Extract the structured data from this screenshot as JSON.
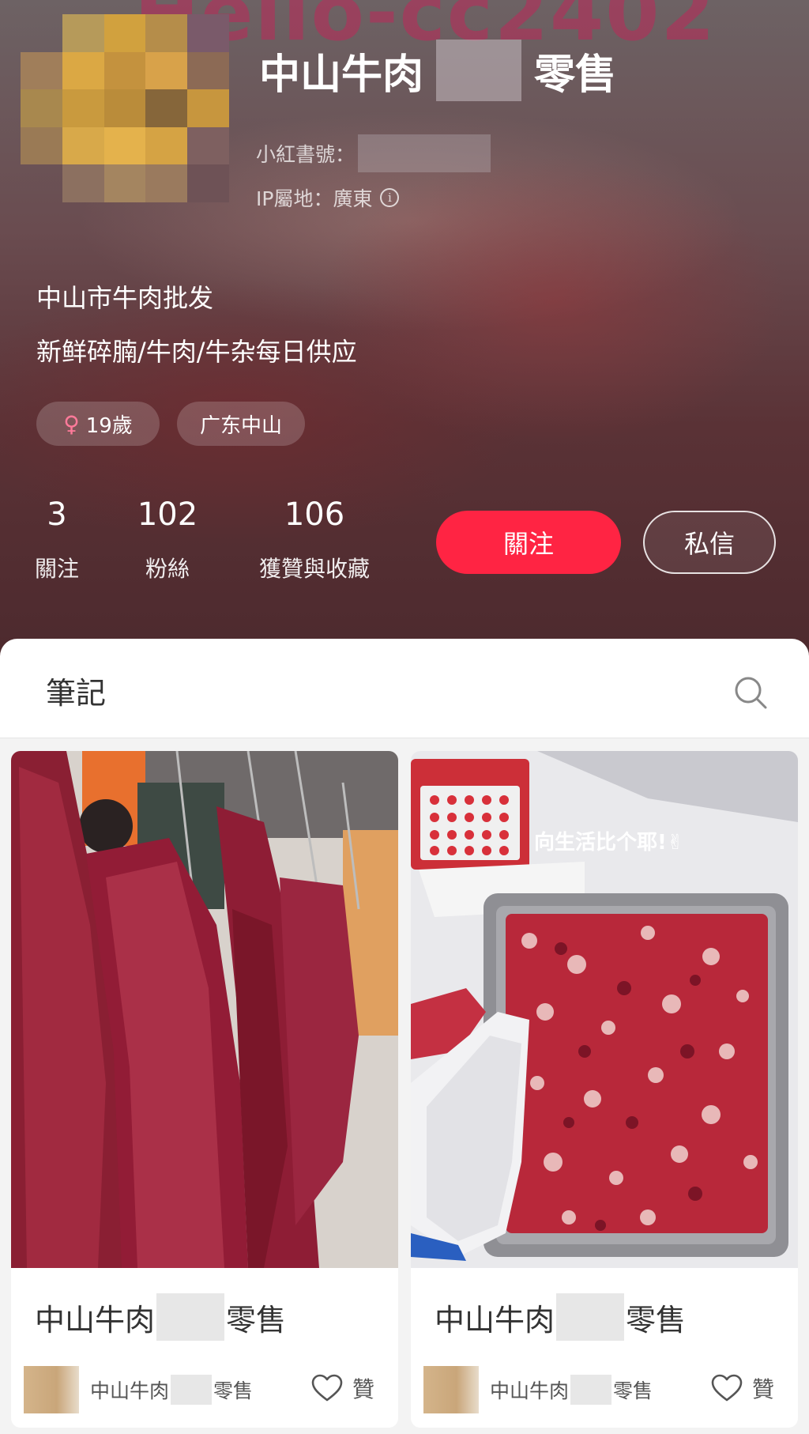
{
  "watermark": {
    "text": "Hello-cc2402"
  },
  "profile": {
    "name_part1": "中山牛肉",
    "name_part2": "零售",
    "redbook_id_label": "小紅書號：",
    "ip_label": "IP屬地：廣東",
    "info_icon": "i",
    "bio_line1": "中山市牛肉批发",
    "bio_line2": "新鲜碎腩/牛肉/牛杂每日供应",
    "tags": {
      "gender_symbol": "♀",
      "age": "19歲",
      "location": "广东中山"
    },
    "stats": {
      "following_count": "3",
      "following_label": "關注",
      "fans_count": "102",
      "fans_label": "粉絲",
      "likes_count": "106",
      "likes_label": "獲贊與收藏"
    },
    "follow_button": "關注",
    "message_button": "私信"
  },
  "notes": {
    "title": "筆記",
    "cards": [
      {
        "title_part1": "中山牛肉",
        "title_part2": "零售",
        "author_part1": "中山牛肉",
        "author_part2": "零售",
        "like_label": "贊"
      },
      {
        "title_part1": "中山牛肉",
        "title_part2": "零售",
        "author_part1": "中山牛肉",
        "author_part2": "零售",
        "like_label": "贊",
        "image_caption": "向生活比个耶!✌"
      }
    ]
  },
  "colors": {
    "accent": "#ff2443",
    "tag_female": "#ff7a9a",
    "header_bg": "#5a3236"
  }
}
